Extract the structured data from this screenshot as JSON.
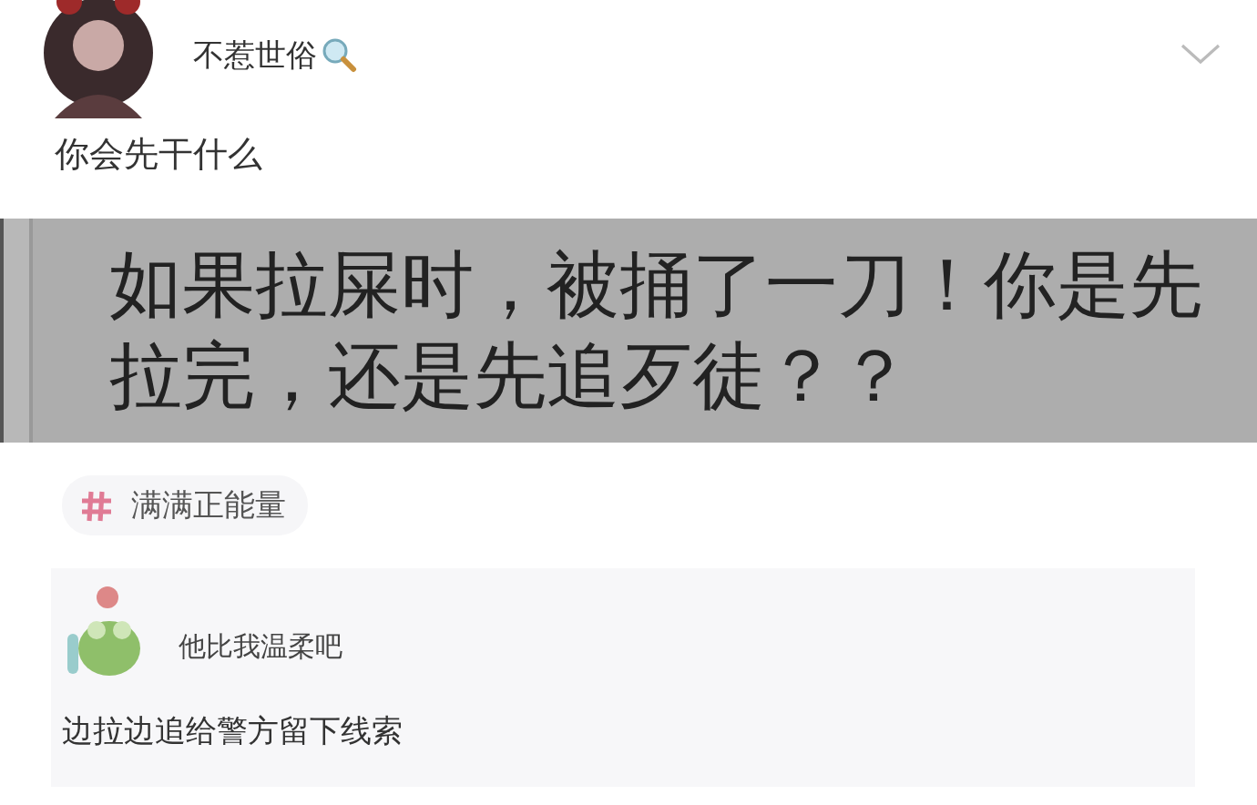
{
  "post": {
    "author": "不惹世俗",
    "text": "你会先干什么",
    "image_text": "如果拉屎时，被捅了一刀！你是先拉完，还是先追歹徒？？",
    "topic": "满满正能量"
  },
  "comment": {
    "author": "他比我温柔吧",
    "text": "边拉边追给警方留下线索"
  }
}
